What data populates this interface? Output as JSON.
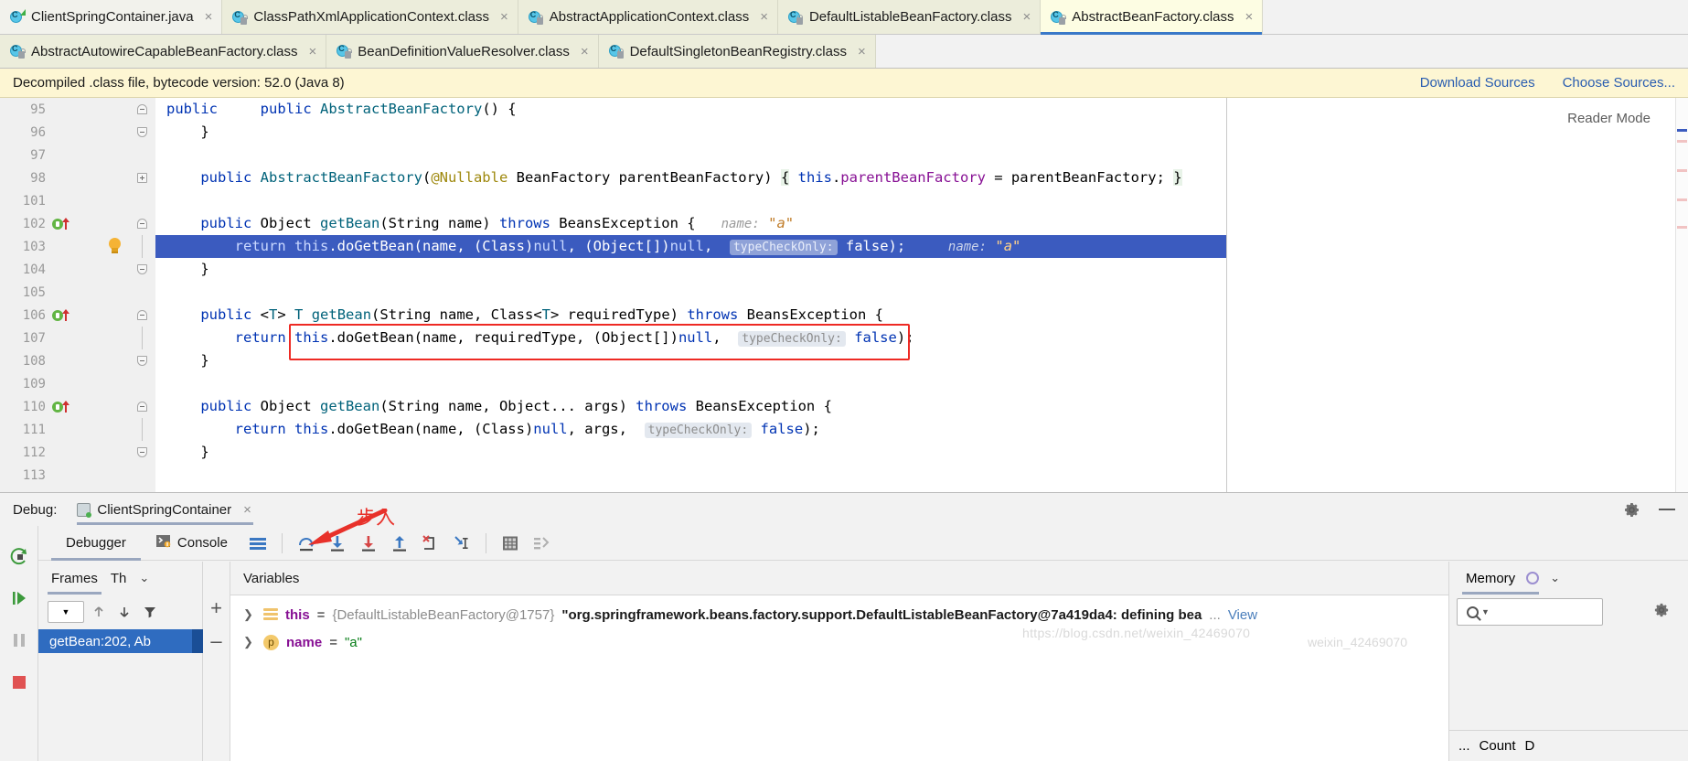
{
  "tabs_row1": [
    {
      "label": "ClientSpringContainer.java",
      "icon": "java-class-icon",
      "type": "java",
      "selected": false
    },
    {
      "label": "ClassPathXmlApplicationContext.class",
      "icon": "class-file-icon",
      "type": "class",
      "selected": false
    },
    {
      "label": "AbstractApplicationContext.class",
      "icon": "class-file-icon",
      "type": "class",
      "selected": false
    },
    {
      "label": "DefaultListableBeanFactory.class",
      "icon": "class-file-icon",
      "type": "class",
      "selected": false
    },
    {
      "label": "AbstractBeanFactory.class",
      "icon": "class-file-icon",
      "type": "class",
      "selected": true
    }
  ],
  "tabs_row2": [
    {
      "label": "AbstractAutowireCapableBeanFactory.class",
      "icon": "class-file-icon",
      "type": "class",
      "selected": false
    },
    {
      "label": "BeanDefinitionValueResolver.class",
      "icon": "class-file-icon",
      "type": "class",
      "selected": false
    },
    {
      "label": "DefaultSingletonBeanRegistry.class",
      "icon": "class-file-icon",
      "type": "class",
      "selected": false
    }
  ],
  "notification": {
    "message": "Decompiled .class file, bytecode version: 52.0 (Java 8)",
    "download_label": "Download Sources",
    "choose_label": "Choose Sources..."
  },
  "editor": {
    "reader_mode_label": "Reader Mode",
    "lines": [
      {
        "num": "95",
        "gutter_overridden": false,
        "fold": "bot",
        "current": false
      },
      {
        "num": "96",
        "gutter_overridden": false,
        "fold": "bot",
        "current": false
      },
      {
        "num": "97",
        "gutter_overridden": false,
        "fold": "none",
        "current": false
      },
      {
        "num": "98",
        "gutter_overridden": false,
        "fold": "plus",
        "current": false
      },
      {
        "num": "101",
        "gutter_overridden": false,
        "fold": "none",
        "current": false
      },
      {
        "num": "102",
        "gutter_overridden": true,
        "fold": "top",
        "current": false
      },
      {
        "num": "103",
        "gutter_overridden": false,
        "fold": "line",
        "current": true
      },
      {
        "num": "104",
        "gutter_overridden": false,
        "fold": "bot",
        "current": false
      },
      {
        "num": "105",
        "gutter_overridden": false,
        "fold": "none",
        "current": false
      },
      {
        "num": "106",
        "gutter_overridden": true,
        "fold": "top",
        "current": false
      },
      {
        "num": "107",
        "gutter_overridden": false,
        "fold": "line",
        "current": false
      },
      {
        "num": "108",
        "gutter_overridden": false,
        "fold": "bot",
        "current": false
      },
      {
        "num": "109",
        "gutter_overridden": false,
        "fold": "none",
        "current": false
      },
      {
        "num": "110",
        "gutter_overridden": true,
        "fold": "top",
        "current": false
      },
      {
        "num": "111",
        "gutter_overridden": false,
        "fold": "line",
        "current": false
      },
      {
        "num": "112",
        "gutter_overridden": false,
        "fold": "bot",
        "current": false
      },
      {
        "num": "113",
        "gutter_overridden": false,
        "fold": "none",
        "current": false
      }
    ],
    "code": {
      "l95": "    public AbstractBeanFactory() {",
      "l96": "    }",
      "l98_a": "    public AbstractBeanFactory(",
      "l98_ann": "@Nullable",
      "l98_b": " BeanFactory parentBeanFactory) { ",
      "l98_this": "this",
      "l98_dot": ".",
      "l98_fld": "parentBeanFactory",
      "l98_c": " = parentBeanFactory; }",
      "l102_a": "    public Object ",
      "l102_m": "getBean",
      "l102_b": "(String name) ",
      "l102_kw": "throws",
      "l102_c": " BeansException {",
      "l102_hint_name": "name:",
      "l102_hint_val": "\"a\"",
      "l103_a": "        return this.",
      "l103_m": "doGetBean",
      "l103_b": "(name, (Class)null, (Object[])null, ",
      "l103_hint": "typeCheckOnly:",
      "l103_c": "false);",
      "l103_trail_name": "name:",
      "l103_trail_val": "\"a\"",
      "l104": "    }",
      "l106_a": "    public <T> T ",
      "l106_m": "getBean",
      "l106_b": "(String name, Class<T> requiredType) ",
      "l106_kw": "throws",
      "l106_c": " BeansException {",
      "l107_a": "        return this.doGetBean(name, requiredType, (Object[])null, ",
      "l107_hint": "typeCheckOnly:",
      "l107_c": "false);",
      "l108": "    }",
      "l110_a": "    public Object ",
      "l110_m": "getBean",
      "l110_b": "(String name, Object... args) ",
      "l110_kw": "throws",
      "l110_c": " BeansException {",
      "l111_a": "        return this.doGetBean(name, (Class)null, args, ",
      "l111_hint": "typeCheckOnly:",
      "l111_c": "false);",
      "l112": "    }"
    }
  },
  "debug": {
    "label": "Debug:",
    "session_name": "ClientSpringContainer",
    "toolbar_tabs": [
      {
        "label": "Debugger",
        "icon": "debugger-icon",
        "active": true
      },
      {
        "label": "Console",
        "icon": "console-icon",
        "active": false
      }
    ],
    "toolbar_icons": [
      {
        "name": "layout-settings-icon"
      },
      {
        "name": "step-over-icon"
      },
      {
        "name": "step-into-icon"
      },
      {
        "name": "force-step-into-icon"
      },
      {
        "name": "step-out-icon"
      },
      {
        "name": "drop-frame-icon"
      },
      {
        "name": "run-to-cursor-icon"
      },
      {
        "name": "evaluate-expression-icon"
      },
      {
        "name": "mute-breakpoints-icon"
      }
    ],
    "rail_icons": [
      {
        "name": "rerun-icon"
      },
      {
        "name": "resume-program-icon"
      },
      {
        "name": "pause-program-icon"
      },
      {
        "name": "stop-icon"
      }
    ],
    "frames": {
      "tab_label": "Frames",
      "threads_label": "Th",
      "rows": [
        {
          "label": "getBean:202, Ab"
        }
      ],
      "buttons": [
        {
          "name": "thread-selector-dropdown"
        },
        {
          "name": "frame-up-icon"
        },
        {
          "name": "frame-down-icon"
        },
        {
          "name": "filter-icon"
        }
      ]
    },
    "variables": {
      "tab_label": "Variables",
      "rows": [
        {
          "icon": "object-node-icon",
          "name": "this",
          "eq": "=",
          "type_value": "{DefaultListableBeanFactory@1757}",
          "string_value": "\"org.springframework.beans.factory.support.DefaultListableBeanFactory@7a419da4: defining bea",
          "ellipsis": "...",
          "view_label": "View"
        },
        {
          "icon": "primitive-node-icon",
          "name": "name",
          "eq": "=",
          "type_value": "",
          "string_value": "\"a\"",
          "ellipsis": "",
          "view_label": ""
        }
      ],
      "add_label": "+",
      "remove_label": "–"
    },
    "memory": {
      "tab_label": "Memory",
      "search_placeholder": "",
      "columns": [
        "...",
        "Count",
        "D"
      ]
    }
  },
  "annotation": {
    "text": "步入",
    "arrow_color": "#e8312a"
  },
  "watermark": {
    "text": "https://blog.csdn.net/weixin_42469070",
    "text2": "weixin_42469070"
  },
  "colors": {
    "accent_blue": "#3b5bbf",
    "tab_selected": "#fdfde3",
    "notification_bg": "#fdf6d3",
    "annotation_red": "#e8312a",
    "frame_selected": "#2f6cc0"
  }
}
